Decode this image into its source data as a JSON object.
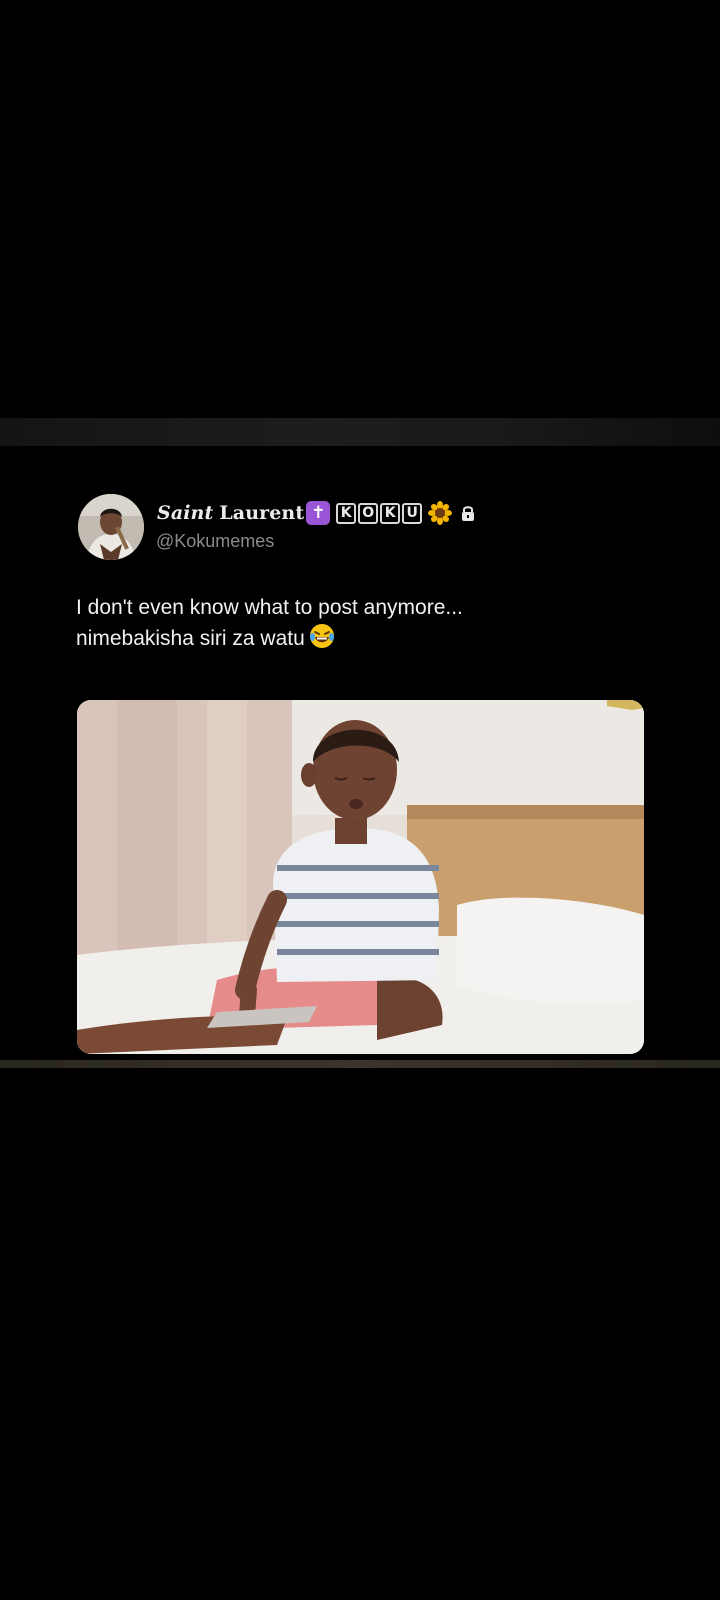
{
  "tweet": {
    "display_name_script": "Saint",
    "display_name_rest": "Laurent",
    "name_emoji": "✝",
    "name_badge_letters": [
      "K",
      "O",
      "K",
      "U"
    ],
    "handle": "@Kokumemes",
    "text_line_1": "I don't even know what to post anymore...",
    "text_line_2": "nimebakisha siri za watu",
    "icons": [
      "latin-cross-icon",
      "sunflower-icon",
      "lock-icon",
      "laughing-tears-icon"
    ],
    "media_alt": "photo",
    "colors": {
      "background": "#000000",
      "text": "#f1f1f1",
      "handle": "#8b8b8b",
      "cross_badge": "#9a55d6"
    }
  }
}
